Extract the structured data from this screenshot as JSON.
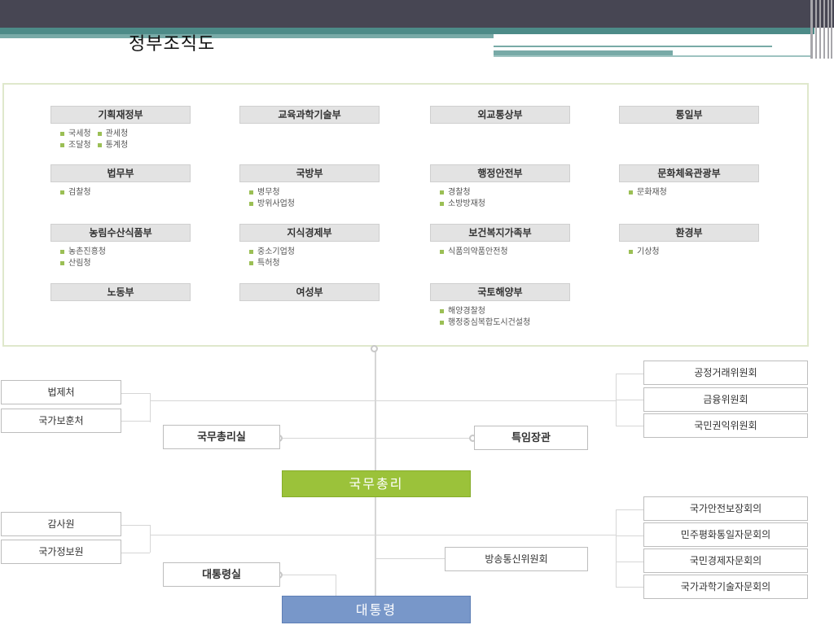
{
  "title": "정부조직도",
  "ministries": [
    {
      "name": "기획재정부",
      "agencies": [
        "국세청",
        "관세청",
        "조달청",
        "통계청"
      ]
    },
    {
      "name": "교육과학기술부",
      "agencies": []
    },
    {
      "name": "외교통상부",
      "agencies": []
    },
    {
      "name": "통일부",
      "agencies": []
    },
    {
      "name": "법무부",
      "agencies": [
        "검찰청"
      ]
    },
    {
      "name": "국방부",
      "agencies": [
        "병무청",
        "방위사업청"
      ]
    },
    {
      "name": "행정안전부",
      "agencies": [
        "경찰청",
        "소방방재청"
      ]
    },
    {
      "name": "문화체육관광부",
      "agencies": [
        "문화재청"
      ]
    },
    {
      "name": "농림수산식품부",
      "agencies": [
        "농촌진흥청",
        "산림청"
      ]
    },
    {
      "name": "지식경제부",
      "agencies": [
        "중소기업청",
        "특허청"
      ]
    },
    {
      "name": "보건복지가족부",
      "agencies": [
        "식품의약품안전청"
      ]
    },
    {
      "name": "환경부",
      "agencies": [
        "기상청"
      ]
    },
    {
      "name": "노동부",
      "agencies": []
    },
    {
      "name": "여성부",
      "agencies": []
    },
    {
      "name": "국토해양부",
      "agencies": [
        "해양경찰청",
        "행정중심복합도시건설청"
      ]
    }
  ],
  "pm": {
    "label": "국무총리",
    "office": "국무총리실",
    "special": "특임장관",
    "left": [
      "법제처",
      "국가보훈처"
    ],
    "right": [
      "공정거래위원회",
      "금융위원회",
      "국민권익위원회"
    ]
  },
  "president": {
    "label": "대통령",
    "office": "대통령실",
    "left": [
      "감사원",
      "국가정보원"
    ],
    "broadcast": "방송통신위원회",
    "right": [
      "국가안전보장회의",
      "민주평화통일자문회의",
      "국민경제자문회의",
      "국가과학기술자문회의"
    ]
  }
}
